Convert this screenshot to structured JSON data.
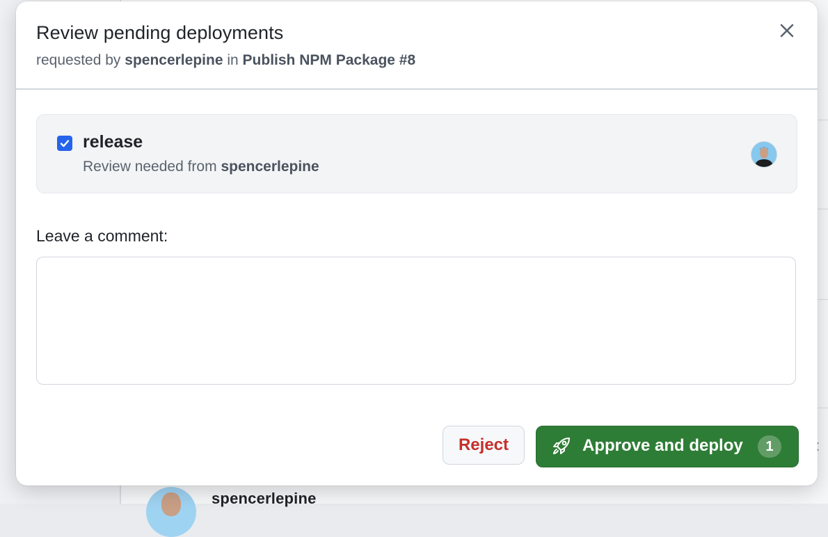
{
  "background": {
    "username": "spencerlepine",
    "colon": ":"
  },
  "modal": {
    "title": "Review pending deployments",
    "subtitle": {
      "prefix": "requested by",
      "requester": "spencerlepine",
      "middle": "in",
      "workflow": "Publish NPM Package #8"
    },
    "close_icon": "close-icon"
  },
  "environment": {
    "name": "release",
    "checked": true,
    "review_prefix": "Review needed from",
    "reviewer": "spencerlepine"
  },
  "comment": {
    "label": "Leave a comment:",
    "value": ""
  },
  "actions": {
    "reject_label": "Reject",
    "approve_label": "Approve and deploy",
    "approve_count": "1",
    "approve_icon": "rocket-icon"
  },
  "colors": {
    "approve": "#2e7d36",
    "reject_text": "#c5302b",
    "checkbox": "#2564eb"
  }
}
